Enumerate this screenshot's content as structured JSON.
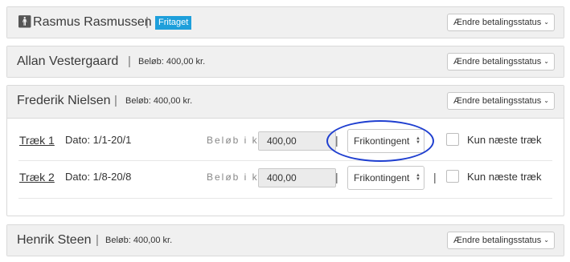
{
  "people": [
    {
      "name": "Rasmus Rasmussen",
      "badge": "Fritaget",
      "status_button": "Ændre betalingsstatus"
    },
    {
      "name": "Allan Vestergaard",
      "amount": "Beløb: 400,00 kr.",
      "status_button": "Ændre betalingsstatus"
    },
    {
      "name": "Frederik Nielsen",
      "amount": "Beløb: 400,00 kr.",
      "status_button": "Ændre betalingsstatus",
      "installments": [
        {
          "title": "Træk 1",
          "date": "Dato: 1/1-20/1",
          "amount_label": "Beløb i kr",
          "amount_value": "400,00",
          "type": "Frikontingent",
          "checkbox_label": "Kun næste træk",
          "checked": false
        },
        {
          "title": "Træk 2",
          "date": "Dato: 1/8-20/8",
          "amount_label": "Beløb i kr",
          "amount_value": "400,00",
          "type": "Frikontingent",
          "checkbox_label": "Kun næste træk",
          "checked": false
        }
      ]
    },
    {
      "name": "Henrik Steen",
      "amount": "Beløb: 400,00 kr.",
      "status_button": "Ændre betalingsstatus"
    }
  ],
  "separator": "|",
  "icons": {
    "person": "person-icon",
    "chevron": "chevron-down-icon",
    "select_arrows": "select-arrows-icon"
  },
  "colors": {
    "badge": "#1e9fdb",
    "highlight": "#1f3fd0"
  }
}
